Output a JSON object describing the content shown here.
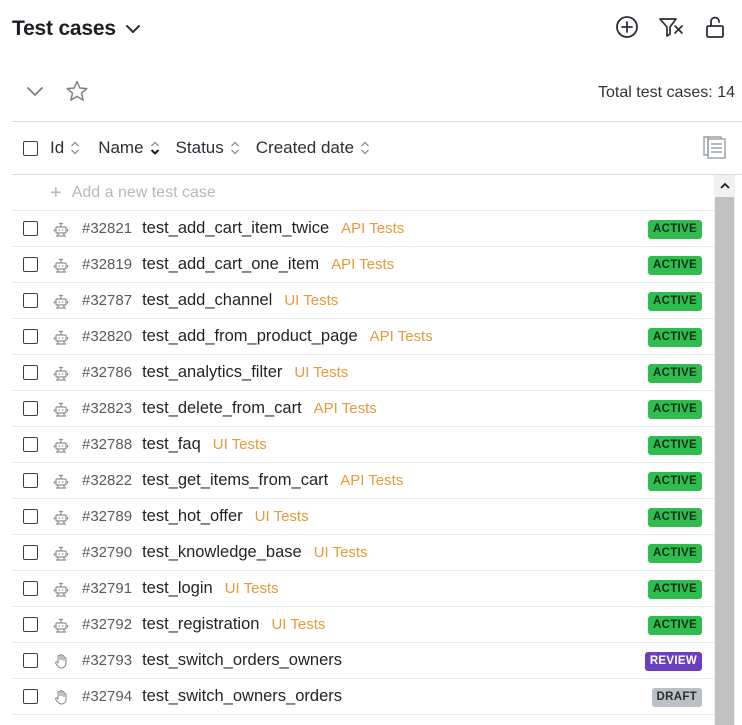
{
  "header": {
    "title": "Test cases",
    "icons": [
      "chevron-down-icon",
      "add-circle-icon",
      "clear-filter-icon",
      "unlock-icon"
    ]
  },
  "subbar": {
    "total_label": "Total test cases: 14",
    "icons": [
      "chevron-down-icon",
      "star-icon"
    ]
  },
  "columns": {
    "id": "Id",
    "name": "Name",
    "status": "Status",
    "created": "Created date"
  },
  "add_row": {
    "label": "Add a new test case"
  },
  "status_colors": {
    "ACTIVE": {
      "bg": "#2ebd4e",
      "fg": "#0f2e16"
    },
    "REVIEW": {
      "bg": "#6b3fc0",
      "fg": "#ffffff"
    },
    "DRAFT": {
      "bg": "#b9c0c8",
      "fg": "#2a2f35"
    }
  },
  "suite_color": "#e89a3c",
  "rows": [
    {
      "id": "#32821",
      "name": "test_add_cart_item_twice",
      "suite": "API Tests",
      "status": "ACTIVE",
      "type_icon": "robot-icon"
    },
    {
      "id": "#32819",
      "name": "test_add_cart_one_item",
      "suite": "API Tests",
      "status": "ACTIVE",
      "type_icon": "robot-icon"
    },
    {
      "id": "#32787",
      "name": "test_add_channel",
      "suite": "UI Tests",
      "status": "ACTIVE",
      "type_icon": "robot-icon"
    },
    {
      "id": "#32820",
      "name": "test_add_from_product_page",
      "suite": "API Tests",
      "status": "ACTIVE",
      "type_icon": "robot-icon"
    },
    {
      "id": "#32786",
      "name": "test_analytics_filter",
      "suite": "UI Tests",
      "status": "ACTIVE",
      "type_icon": "robot-icon"
    },
    {
      "id": "#32823",
      "name": "test_delete_from_cart",
      "suite": "API Tests",
      "status": "ACTIVE",
      "type_icon": "robot-icon"
    },
    {
      "id": "#32788",
      "name": "test_faq",
      "suite": "UI Tests",
      "status": "ACTIVE",
      "type_icon": "robot-icon"
    },
    {
      "id": "#32822",
      "name": "test_get_items_from_cart",
      "suite": "API Tests",
      "status": "ACTIVE",
      "type_icon": "robot-icon"
    },
    {
      "id": "#32789",
      "name": "test_hot_offer",
      "suite": "UI Tests",
      "status": "ACTIVE",
      "type_icon": "robot-icon"
    },
    {
      "id": "#32790",
      "name": "test_knowledge_base",
      "suite": "UI Tests",
      "status": "ACTIVE",
      "type_icon": "robot-icon"
    },
    {
      "id": "#32791",
      "name": "test_login",
      "suite": "UI Tests",
      "status": "ACTIVE",
      "type_icon": "robot-icon"
    },
    {
      "id": "#32792",
      "name": "test_registration",
      "suite": "UI Tests",
      "status": "ACTIVE",
      "type_icon": "robot-icon"
    },
    {
      "id": "#32793",
      "name": "test_switch_orders_owners",
      "suite": "",
      "status": "REVIEW",
      "type_icon": "hand-icon"
    },
    {
      "id": "#32794",
      "name": "test_switch_owners_orders",
      "suite": "",
      "status": "DRAFT",
      "type_icon": "hand-icon"
    }
  ]
}
